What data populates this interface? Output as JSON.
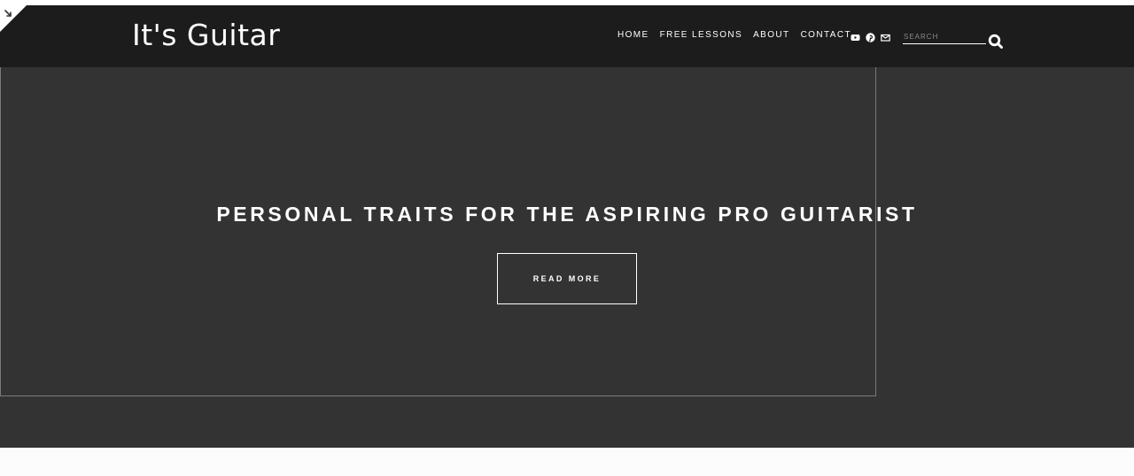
{
  "header": {
    "logo": "It's Guitar",
    "nav": [
      {
        "label": "HOME"
      },
      {
        "label": "FREE LESSONS"
      },
      {
        "label": "ABOUT"
      },
      {
        "label": "CONTACT"
      }
    ],
    "social": [
      "youtube-icon",
      "pinterest-icon",
      "email-icon"
    ],
    "search": {
      "placeholder": "SEARCH"
    }
  },
  "hero": {
    "title": "PERSONAL TRAITS FOR THE ASPIRING PRO GUITARIST",
    "button_label": "READ MORE"
  },
  "colors": {
    "header_bg": "#1c1c1c",
    "hero_bg": "#333333",
    "text": "#ffffff"
  }
}
